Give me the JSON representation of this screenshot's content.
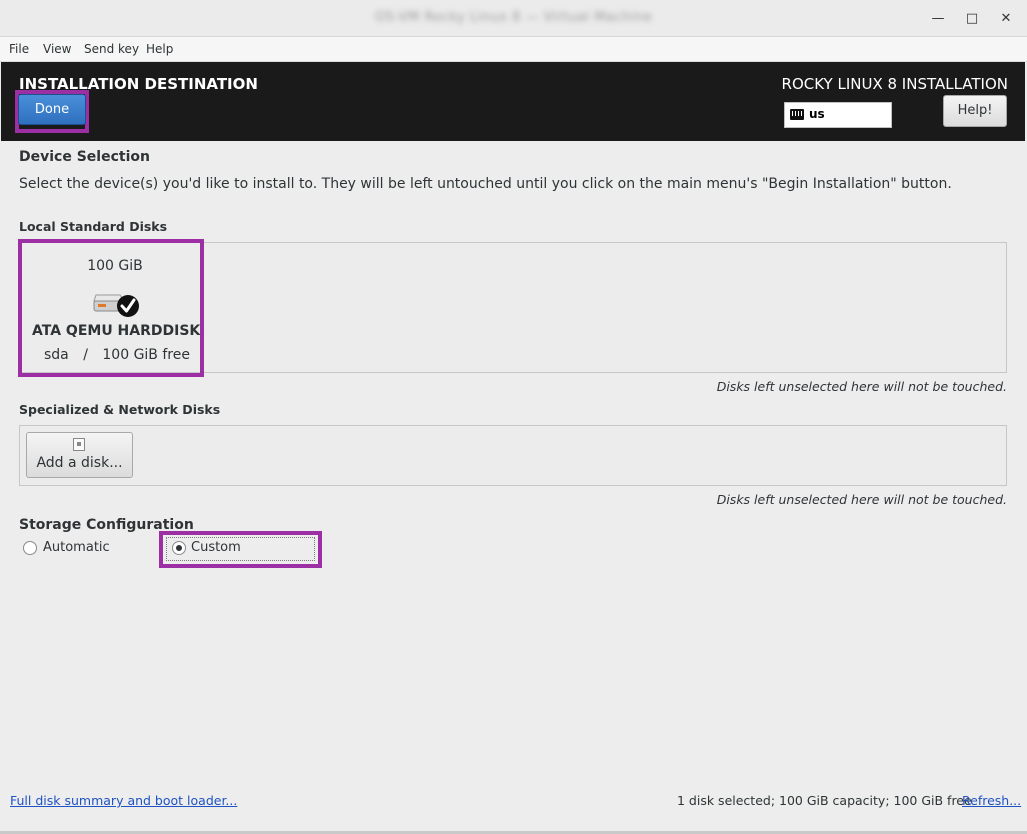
{
  "window": {
    "title": "OS-VM Rocky Linux 8 — Virtual Machine",
    "minimize": "—",
    "maximize": "□",
    "close": "✕"
  },
  "menu": [
    "File",
    "View",
    "Send key",
    "Help"
  ],
  "header": {
    "spoke_title": "INSTALLATION DESTINATION",
    "product_title": "ROCKY LINUX 8 INSTALLATION",
    "done_label": "Done",
    "keyboard_layout": "us",
    "help_label": "Help!"
  },
  "device_selection": {
    "heading": "Device Selection",
    "description": "Select the device(s) you'd like to install to.  They will be left untouched until you click on the main menu's \"Begin Installation\" button."
  },
  "local_disks": {
    "heading": "Local Standard Disks",
    "disk": {
      "size": "100 GiB",
      "name": "ATA QEMU HARDDISK",
      "device": "sda",
      "separator": "/",
      "free": "100 GiB free",
      "selected": true
    },
    "note": "Disks left unselected here will not be touched."
  },
  "network_disks": {
    "heading": "Specialized & Network Disks",
    "add_label": "Add a disk...",
    "note": "Disks left unselected here will not be touched."
  },
  "storage": {
    "heading": "Storage Configuration",
    "options": [
      {
        "label": "Automatic",
        "selected": false
      },
      {
        "label": "Custom",
        "selected": true
      }
    ]
  },
  "footer": {
    "summary_link": "Full disk summary and boot loader...",
    "status": "1 disk selected; 100 GiB capacity; 100 GiB free",
    "refresh_link": "Refresh..."
  },
  "colors": {
    "highlight": "#9b2fa3",
    "header_bg": "#1a1a1a",
    "done_blue": "#3b7fd0",
    "link": "#1f52c2"
  }
}
